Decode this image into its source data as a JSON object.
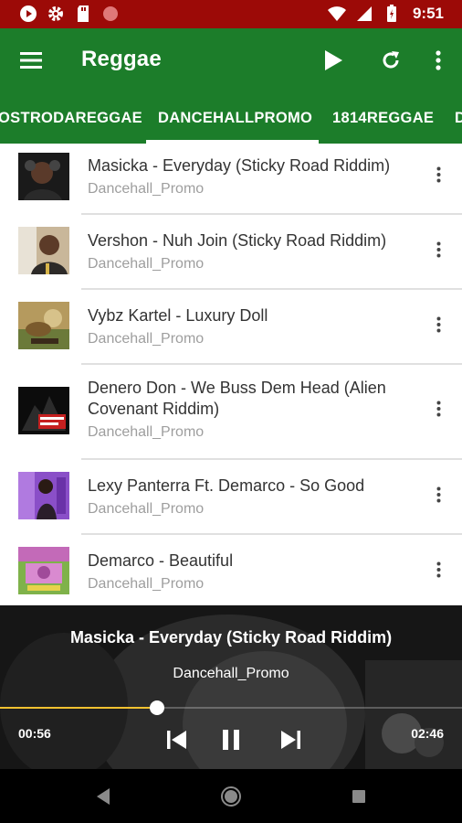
{
  "status_bar": {
    "time": "9:51",
    "left_icons": [
      "play-circle-icon",
      "gear-icon",
      "sd-card-icon",
      "record-icon"
    ],
    "right_icons": [
      "wifi-icon",
      "signal-icon",
      "battery-icon"
    ],
    "color": "#9c0a07"
  },
  "toolbar": {
    "title": "Reggae",
    "menu_icon": "hamburger-menu-icon",
    "actions": [
      "play-icon",
      "refresh-icon",
      "more-vert-icon"
    ],
    "color": "#1c7d2a"
  },
  "tabs": {
    "items": [
      "OSTRODAREGGAE",
      "DANCEHALLPROMO",
      "1814REGGAE",
      "D"
    ],
    "selected": "DANCEHALLPROMO"
  },
  "tracks": [
    {
      "title": "Masicka - Everyday (Sticky Road Riddim)",
      "channel": "Dancehall_Promo"
    },
    {
      "title": "Vershon - Nuh Join (Sticky Road Riddim)",
      "channel": "Dancehall_Promo"
    },
    {
      "title": "Vybz Kartel - Luxury Doll",
      "channel": "Dancehall_Promo"
    },
    {
      "title": "Denero Don - We Buss Dem Head (Alien Covenant Riddim)",
      "channel": "Dancehall_Promo"
    },
    {
      "title": "Lexy Panterra Ft. Demarco - So Good",
      "channel": "Dancehall_Promo"
    },
    {
      "title": "Demarco - Beautiful",
      "channel": "Dancehall_Promo"
    }
  ],
  "player": {
    "title": "Masicka - Everyday (Sticky Road Riddim)",
    "channel": "Dancehall_Promo",
    "elapsed": "00:56",
    "duration": "02:46",
    "progress": 0.34,
    "accent": "#f2c230",
    "controls": [
      "skip-previous-icon",
      "pause-icon",
      "skip-next-icon"
    ]
  },
  "navbar": {
    "buttons": [
      "back-icon",
      "home-icon",
      "recents-icon"
    ]
  }
}
